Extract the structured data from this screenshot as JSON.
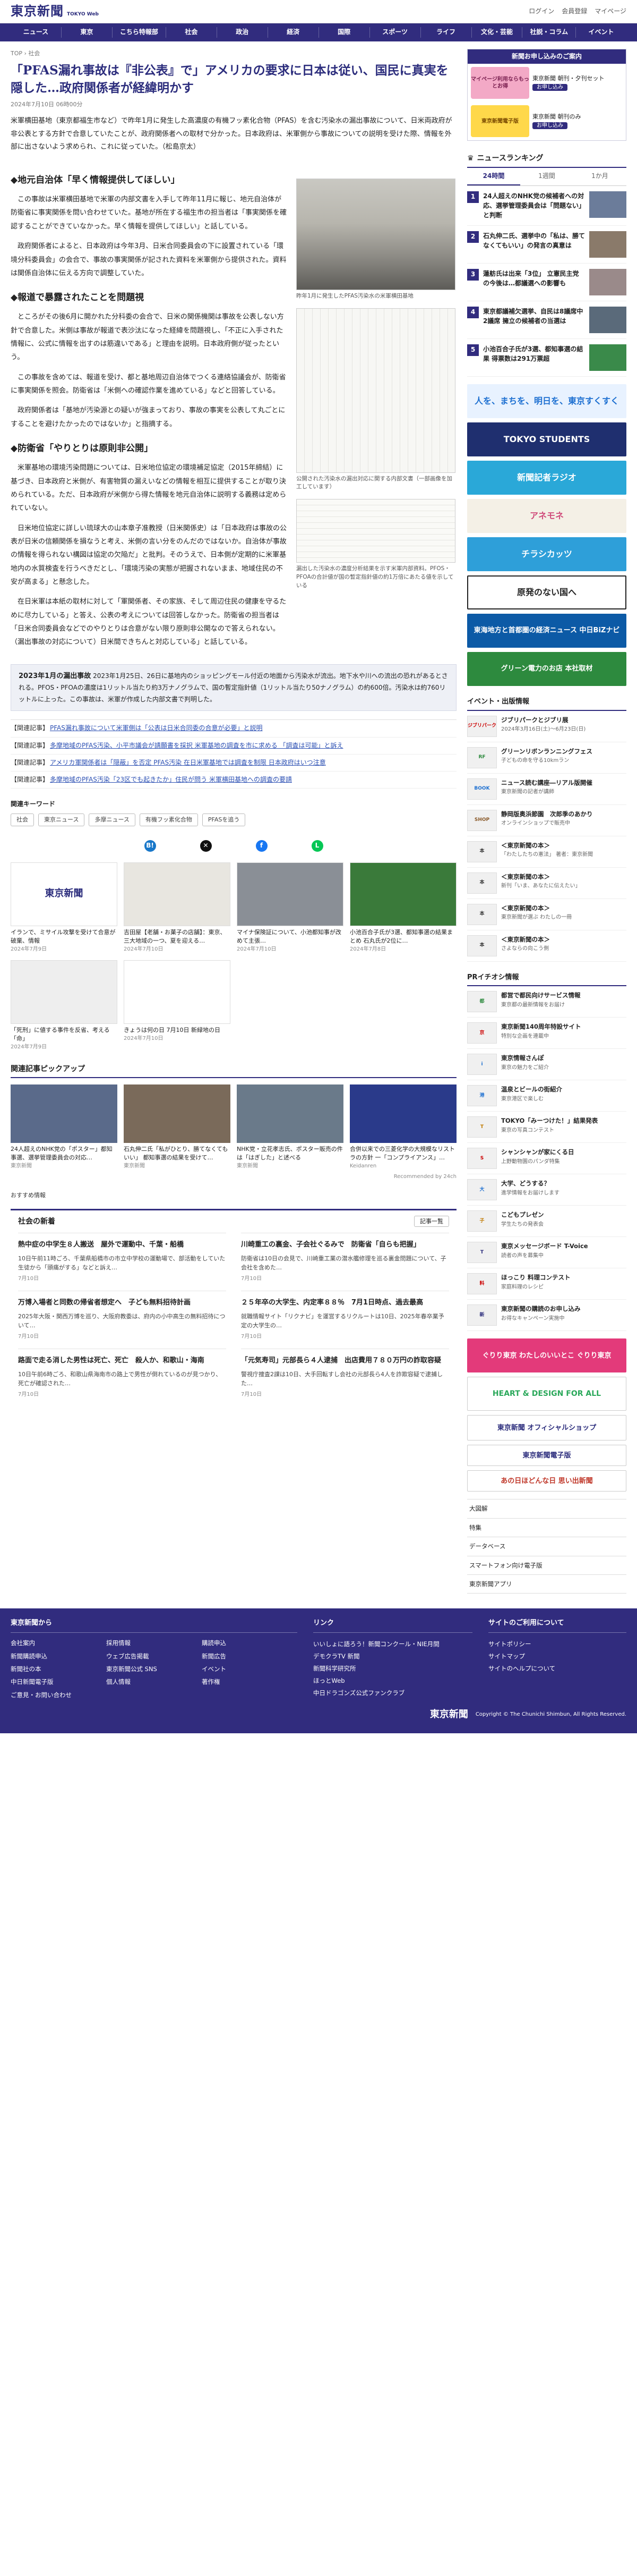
{
  "header": {
    "logo": "東京新聞",
    "logo_sub": "TOKYO Web",
    "links": [
      "ログイン",
      "会員登録",
      "マイページ"
    ]
  },
  "nav": [
    "ニュース",
    "東京",
    "こちら特報部",
    "社会",
    "政治",
    "経済",
    "国際",
    "スポーツ",
    "ライフ",
    "文化・芸能",
    "社説・コラム",
    "イベント"
  ],
  "breadcrumb": [
    "TOP",
    "社会"
  ],
  "article": {
    "headline": "「PFAS漏れ事故は『非公表』で」アメリカの要求に日本は従い、国民に真実を隠した…政府関係者が経緯明かす",
    "date": "2024年7月10日 06時00分",
    "lead": "米軍横田基地（東京都福生市など）で昨年1月に発生した高濃度の有機フッ素化合物（PFAS）を含む汚染水の漏出事故について、日米両政府が非公表とする方針で合意していたことが、政府関係者への取材で分かった。日本政府は、米軍側から事故についての説明を受けた際、情報を外部に出さないよう求められ、これに従っていた。（松島京太）",
    "sec1": "◆地元自治体「早く情報提供してほしい」",
    "sec2": "◆報道で暴露されたことを問題視",
    "sec3": "◆防衛省「やりとりは原則非公開」",
    "p1": "この事故は米軍横田基地で米軍の内部文書を入手して昨年11月に報じ、地元自治体が防衛省に事実関係を問い合わせていた。基地が所在する福生市の担当者は「事実関係を確認することができていなかった。早く情報を提供してほしい」と話している。",
    "p2": "政府関係者によると、日本政府は今年3月、日米合同委員会の下に設置されている「環境分科委員会」の会合で、事故の事実関係が記された資料を米軍側から提供された。資料は関係自治体に伝える方向で調整していた。",
    "p3": "ところがその後6月に開かれた分科委の会合で、日米の関係機関は事故を公表しない方針で合意した。米側は事故が報道で表沙汰になった経緯を問題視し、「不正に入手された情報に、公式に情報を出すのは筋違いである」と理由を説明。日本政府側が従ったという。",
    "p4": "この事故を含めては、報道を受け、都と基地周辺自治体でつくる連絡協議会が、防衛省に事実関係を照会。防衛省は「米側への確認作業を進めている」などと回答している。",
    "p5": "政府関係者は「基地が汚染源との疑いが強まっており、事故の事実を公表して丸ごとにすることを避けたかったのではないか」と指摘する。",
    "p6": "米軍基地の環境汚染問題については、日米地位協定の環境補足協定（2015年締結）に基づき、日本政府と米側が、有害物質の漏えいなどの情報を相互に提供することが取り決められている。ただ、日本政府が米側から得た情報を地元自治体に説明する義務は定められていない。",
    "p7": "日米地位協定に詳しい琉球大の山本章子准教授（日米関係史）は「日本政府は事故の公表が日米の信頼関係を損なうと考え、米側の言い分をのんだのではないか。自治体が事故の情報を得られない構図は協定の欠陥だ」と批判。そのうえで、日本側が定期的に米軍基地内の水質検査を行うべきだとし、「環境汚染の実態が把握されないまま、地域住民の不安が高まる」と懸念した。",
    "p8": "在日米軍は本紙の取材に対して「軍関係者、その家族、そして周辺住民の健康を守るために尽力している」と答え、公表の考えについては回答しなかった。防衛省の担当者は「日米合同委員会などでのやりとりは合意がない限り原則非公開なので答えられない。（漏出事故の対応について）日米間できちんと対応している」と話している。",
    "fig1_caption": "昨年1月に発生したPFAS汚染水の米軍横田基地",
    "fig2_caption": "公開された汚染水の漏出対応に関する内部文書（一部画像を加工しています）",
    "fig3_caption": "漏出した汚染水の濃度分析結果を示す米軍内部資料。PFOS・PFOAの合計値が国の暫定指針値の約1万倍にあたる値を示している",
    "info_title": "2023年1月の漏出事故",
    "info_text": "2023年1月25日、26日に基地内のショッピングモール付近の地面から汚染水が流出。地下水や川への流出の恐れがあるとされる。PFOS・PFOAの濃度は1リットル当たり約3万ナノグラムで、国の暫定指針値（1リットル当たり50ナノグラム）の約600倍。汚染水は約760リットルに上った。この事故は、米軍が作成した内部文書で判明した。"
  },
  "related": [
    {
      "tag": "【関連記事】",
      "text": "PFAS漏れ事故について米軍側は「公表は日米合同委の合意が必要」と説明"
    },
    {
      "tag": "【関連記事】",
      "text": "多摩地域のPFAS汚染、小平市議会が請願書を採択 米軍基地の調査を市に求める 「調査は可能」と訴え"
    },
    {
      "tag": "【関連記事】",
      "text": "アメリカ軍関係者は「隠蔽」を否定 PFAS汚染 在日米軍基地では調査を制限 日本政府はいつ注意"
    },
    {
      "tag": "【関連記事】",
      "text": "多摩地域のPFAS汚染「23区でも起きたか」住民が問う 米軍横田基地への調査の要請"
    }
  ],
  "keywords": {
    "title": "関連キーワード",
    "items": [
      "社会",
      "東京ニュース",
      "多摩ニュース",
      "有機フッ素化合物",
      "PFASを追う"
    ]
  },
  "thumbs": [
    {
      "title": "イランで、ミサイル攻撃を受けて合意が破棄、情報",
      "date": "2024年7月9日"
    },
    {
      "title": "吉田屋【老舗・お菓子の店舗】：東京、三大地域の一つ、夏を迎える…",
      "date": "2024年7月10日"
    },
    {
      "title": "マイナ保険証について、小池都知事が改めて主張…",
      "date": "2024年7月10日"
    },
    {
      "title": "小池百合子氏が3選、都知事選の結果まとめ 石丸氏が2位に…",
      "date": "2024年7月8日"
    }
  ],
  "thumbs2": [
    {
      "title": "「死刑」に値する事件を反省、考える「命」",
      "date": "2024年7月9日"
    },
    {
      "title": "きょうは何の日 7月10日 新緑地の日",
      "date": "2024年7月10日"
    }
  ],
  "pickup": {
    "title": "関連記事ピックアップ",
    "items": [
      {
        "title": "24人超えのNHK党の「ポスター」都知事選、選挙管理委員会の対応…",
        "src": "東京新聞"
      },
      {
        "title": "石丸伸二氏「私がひとり、勝てなくてもいい」 都知事選の結果を受けて…",
        "src": "東京新聞"
      },
      {
        "title": "NHK党・立花孝志氏、ポスター販売の件は「はぎした」と述べる",
        "src": "東京新聞"
      },
      {
        "title": "合併以来での三菱化学の大規模なリストラの方針 一「コンプライアンス」…",
        "src": "Keidanren"
      }
    ],
    "pr": "Recommended by 24ch"
  },
  "social": {
    "more_label": "おすすめ情報",
    "title": "社会の新着",
    "btn": "記事一覧",
    "items": [
      {
        "title": "熱中症の中学生８人搬送　屋外で運動中、千葉・船橋",
        "text": "10日午前11時ごろ、千葉県船橋市の市立中学校の運動場で、部活動をしていた生徒から「頭痛がする」などと訴え…",
        "date": "7月10日"
      },
      {
        "title": "川崎重工の裏金、子会社ぐるみで　防衛省「自らも把握」",
        "text": "防衛省は10日の会見で、川崎重工業の潜水艦修理を巡る裏金問題について、子会社を含めた…",
        "date": "7月10日"
      },
      {
        "title": "万博入場者と同数の帰省者想定へ　子ども無料招待計画",
        "text": "2025年大阪・関西万博を巡り、大阪府教委は、府内の小中高生の無料招待について…",
        "date": "7月10日"
      },
      {
        "title": "２５年卒の大学生、内定率８８％　7月1日時点、過去最高",
        "text": "就職情報サイト「リクナビ」を運営するリクルートは10日、2025年春卒業予定の大学生の…",
        "date": "7月10日"
      },
      {
        "title": "路面で走る消した男性は死亡、死亡　殺人か、和歌山・海南",
        "text": "10日午前6時ごろ、和歌山県海南市の路上で男性が倒れているのが見つかり、死亡が確認された…",
        "date": "7月10日"
      },
      {
        "title": "「元気寿司」元部長ら４人逮捕　出店費用７８０万円の詐取容疑",
        "text": "警視庁捜査2課は10日、大手回転すし会社の元部長ら4人を詐欺容疑で逮捕した…",
        "date": "7月10日"
      }
    ]
  },
  "sidebar": {
    "banner_title": "新聞お申し込みのご案内",
    "banner_items": [
      {
        "box": "マイページ利用ならもっとお得",
        "text": "東京新聞 朝刊・夕刊セット",
        "btn": "お申し込み"
      },
      {
        "box": "東京新聞電子版",
        "text": "東京新聞 朝刊のみ",
        "btn": "お申し込み"
      }
    ],
    "ranking_title": "ニュースランキング",
    "ranking_tabs": [
      "24時間",
      "1週間",
      "1か月"
    ],
    "ranking": [
      {
        "num": "1",
        "text": "24人超えのNHK党の候補者への対応、選挙管理委員会は「問題ない」と判断"
      },
      {
        "num": "2",
        "text": "石丸伸二氏、選挙中の「私は、勝てなくてもいい」の発言の真意は"
      },
      {
        "num": "3",
        "text": "蓮舫氏は出来「3位」 立憲民主党の今後は…都議選への影響も"
      },
      {
        "num": "4",
        "text": "東京都議補欠選挙、自民は8議席中2議席 擁立の候補者の当選は"
      },
      {
        "num": "5",
        "text": "小池百合子氏が3選、都知事選の結果 得票数は291万票超"
      }
    ],
    "ads": [
      {
        "text": "人を、まちを、明日を、東京すくすく"
      },
      {
        "text": "TOKYO STUDENTS"
      },
      {
        "text": "新聞記者ラジオ"
      },
      {
        "text": "アネモネ"
      },
      {
        "text": "チラシカッツ"
      },
      {
        "text": "原発のない国へ"
      },
      {
        "text": "東海地方と首都圏の経済ニュース 中日BiZナビ"
      },
      {
        "text": "グリーン電力のお店 本社取材"
      }
    ],
    "events_title": "イベント・出版情報",
    "events": [
      {
        "logo": "ジブリパーク",
        "title": "ジブリパークとジブリ展",
        "sub": "2024年3月16日(土)～6月23日(日)"
      },
      {
        "logo": "RF",
        "title": "グリーンリボンランニングフェス",
        "sub": "子どもの命を守る10kmラン"
      },
      {
        "logo": "BOOK",
        "title": "ニュース読む講座―リアル版開催",
        "sub": "東京新聞の記者が講師"
      },
      {
        "logo": "SHOP",
        "title": "静岡版奥浜節園　次郎季のあかり",
        "sub": "オンラインショップで販売中"
      },
      {
        "logo": "本",
        "title": "＜東京新聞の本＞",
        "sub": "「わたしたちの憲法」 著者：東京新聞"
      },
      {
        "logo": "本",
        "title": "＜東京新聞の本＞",
        "sub": "新刊「いま、あなたに伝えたい」"
      },
      {
        "logo": "本",
        "title": "＜東京新聞の本＞",
        "sub": "東京新聞が選ぶ わたしの一冊"
      },
      {
        "logo": "本",
        "title": "＜東京新聞の本＞",
        "sub": "さよならの向こう側"
      }
    ],
    "pr_title": "PRイチオシ情報",
    "pr_items": [
      {
        "logo": "都",
        "title": "都営で都民向けサービス情報",
        "sub": "東京都の最新情報をお届け"
      },
      {
        "logo": "京",
        "title": "東京新聞140周年特設サイト",
        "sub": "特別な企画を連載中"
      },
      {
        "logo": "i",
        "title": "東京情報さんぽ",
        "sub": "東京の魅力をご紹介"
      },
      {
        "logo": "港",
        "title": "温泉とビールの街紹介",
        "sub": "東京港区で楽しむ"
      },
      {
        "logo": "T",
        "title": "TOKYO「みーつけた！」結果発表",
        "sub": "東京の写真コンテスト"
      },
      {
        "logo": "S",
        "title": "シャンシャンが家にくる日",
        "sub": "上野動物園のパンダ特集"
      },
      {
        "logo": "大",
        "title": "大学、どうする？",
        "sub": "進学情報をお届けします"
      },
      {
        "logo": "子",
        "title": "こどもプレゼン",
        "sub": "学生たちの発表会"
      },
      {
        "logo": "T",
        "title": "東京メッセージボード T-Voice",
        "sub": "読者の声を募集中"
      },
      {
        "logo": "料",
        "title": "ほっこり 料理コンテスト",
        "sub": "家庭料理のレシピ"
      },
      {
        "logo": "新",
        "title": "東京新聞の購読のお申し込み",
        "sub": "お得なキャンペーン実施中"
      }
    ],
    "ads2": [
      {
        "text": "ぐりり東京 わたしのいいとこ ぐりり東京"
      },
      {
        "text": "HEART & DESIGN FOR ALL"
      },
      {
        "text": "東京新聞 オフィシャルショップ"
      },
      {
        "text": "東京新聞電子版"
      },
      {
        "text": "あの日ほどんな日 思い出新聞"
      }
    ],
    "links": [
      "大図解",
      "特集",
      "データベース",
      "スマートフォン向け電子版",
      "東京新聞アプリ"
    ]
  },
  "footer": {
    "col1_title": "東京新聞から",
    "col1": [
      "会社案内",
      "採用情報",
      "購読申込",
      "新聞購読申込",
      "ウェブ広告掲載",
      "新聞広告",
      "新聞社の本",
      "東京新聞公式 SNS",
      "イベント",
      "中日新聞電子版",
      "個人情報",
      "著作権",
      "ご意見・お問い合わせ"
    ],
    "col2_title": "リンク",
    "col2": [
      "いいしょに語ろう！新聞コンクール・NIE月間",
      "デモクラTV 新聞",
      "新聞科学研究所",
      "ほっとWeb",
      "中日ドラゴンズ公式ファンクラブ"
    ],
    "col3_title": "サイトのご利用について",
    "col3": [
      "サイトポリシー",
      "サイトマップ",
      "サイトのヘルプについて"
    ],
    "copyright": "Copyright © The Chunichi Shimbun, All Rights Reserved.",
    "logo": "東京新聞"
  }
}
